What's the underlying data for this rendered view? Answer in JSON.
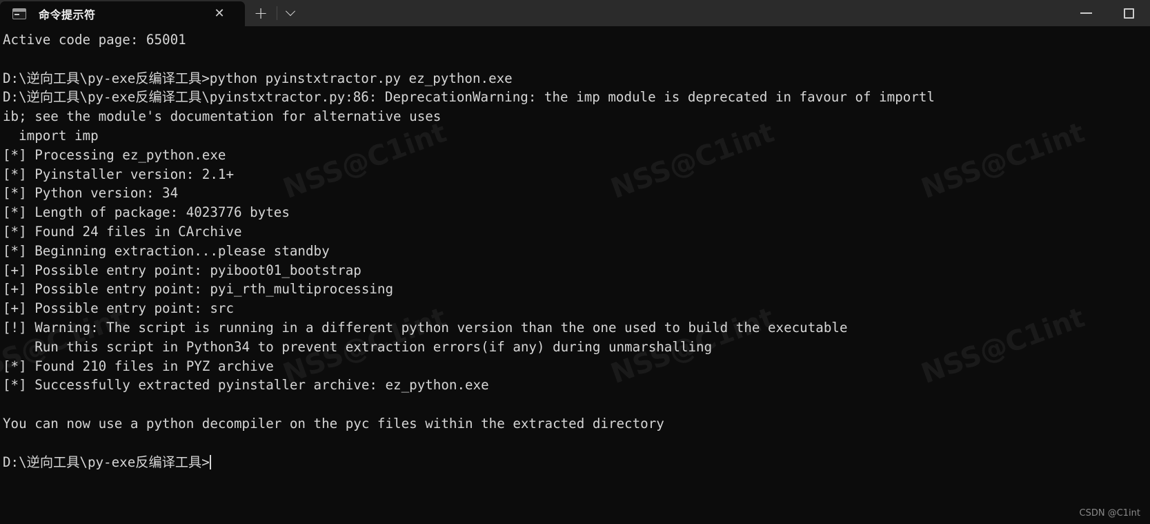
{
  "window": {
    "titlebar": {
      "tab": {
        "icon": "console-icon",
        "title": "命令提示符",
        "close_label": "✕"
      },
      "new_tab_label": "+",
      "dropdown_label": "chevron-down",
      "minimize_label": "minimize",
      "maximize_label": "maximize"
    }
  },
  "terminal": {
    "prompt_cwd": "D:\\逆向工具\\py-exe反编译工具>",
    "lines": [
      "Active code page: 65001",
      "",
      "D:\\逆向工具\\py-exe反编译工具>python pyinstxtractor.py ez_python.exe",
      "D:\\逆向工具\\py-exe反编译工具\\pyinstxtractor.py:86: DeprecationWarning: the imp module is deprecated in favour of importl",
      "ib; see the module's documentation for alternative uses",
      "  import imp",
      "[*] Processing ez_python.exe",
      "[*] Pyinstaller version: 2.1+",
      "[*] Python version: 34",
      "[*] Length of package: 4023776 bytes",
      "[*] Found 24 files in CArchive",
      "[*] Beginning extraction...please standby",
      "[+] Possible entry point: pyiboot01_bootstrap",
      "[+] Possible entry point: pyi_rth_multiprocessing",
      "[+] Possible entry point: src",
      "[!] Warning: The script is running in a different python version than the one used to build the executable",
      "    Run this script in Python34 to prevent extraction errors(if any) during unmarshalling",
      "[*] Found 210 files in PYZ archive",
      "[*] Successfully extracted pyinstaller archive: ez_python.exe",
      "",
      "You can now use a python decompiler on the pyc files within the extracted directory",
      "",
      "D:\\逆向工具\\py-exe反编译工具>"
    ],
    "cursor_visible": true
  },
  "watermarks": {
    "background_text": "NSS@C1int",
    "corner_credit": "CSDN @C1int"
  },
  "colors": {
    "titlebar_bg": "#2b2b2b",
    "terminal_bg": "#0c0c0c",
    "text_fg": "#d6d6d6",
    "tab_active_bg": "#0c0c0c"
  }
}
